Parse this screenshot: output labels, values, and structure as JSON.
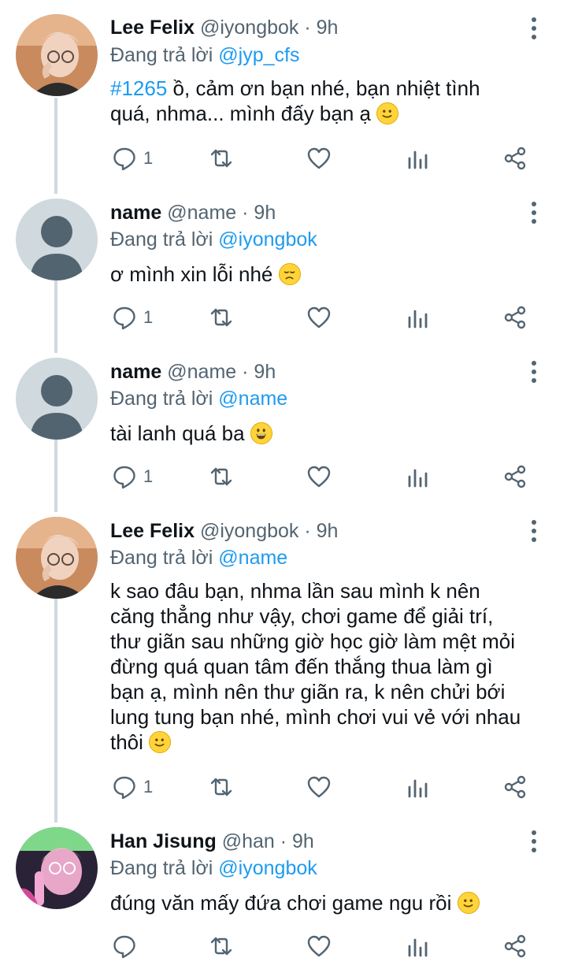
{
  "reply_prefix": "Đang trả lời",
  "tweets": [
    {
      "name": "Lee Felix",
      "handle": "@iyongbok",
      "time": "· 9h",
      "replying_to": "@jyp_cfs",
      "hashtag": "#1265",
      "text_lines": [
        "ồ, cảm ơn bạn nhé, bạn nhiệt tình",
        "quá, nhma... mình đấy bạn ạ"
      ],
      "emoji": "slightly-smiling-face",
      "reply_count": "1"
    },
    {
      "name": "name",
      "handle": "@name",
      "time": "· 9h",
      "replying_to": "@iyongbok",
      "text_lines": [
        "ơ mình xin lỗi nhé"
      ],
      "emoji": "disappointed-face",
      "reply_count": "1"
    },
    {
      "name": "name",
      "handle": "@name",
      "time": "· 9h",
      "replying_to": "@name",
      "text_lines": [
        "tài lanh quá ba"
      ],
      "emoji": "grinning-face",
      "reply_count": "1"
    },
    {
      "name": "Lee Felix",
      "handle": "@iyongbok",
      "time": "· 9h",
      "replying_to": "@name",
      "text_lines": [
        "k sao đâu bạn, nhma lần sau mình k nên",
        "căng thẳng như vậy, chơi game để giải trí,",
        "thư giãn sau những giờ học giờ làm mệt mỏi",
        "đừng quá quan tâm đến thắng thua làm gì",
        "bạn ạ, mình nên thư giãn ra, k nên chửi bới",
        "lung tung bạn nhé, mình chơi vui vẻ với nhau",
        "thôi"
      ],
      "emoji": "slightly-smiling-face",
      "reply_count": "1"
    },
    {
      "name": "Han Jisung",
      "handle": "@han",
      "time": "· 9h",
      "replying_to": "@iyongbok",
      "text_lines": [
        "đúng văn mấy đứa chơi game ngu rồi"
      ],
      "emoji": "slightly-smiling-face",
      "reply_count": ""
    }
  ],
  "icons": {
    "reply": "reply-icon",
    "retweet": "retweet-icon",
    "like": "heart-icon",
    "analytics": "analytics-icon",
    "share": "share-icon",
    "more": "more-options-icon"
  },
  "colors": {
    "link": "#1d9bf0",
    "secondary_text": "#536471",
    "thread_line": "#cfd9de"
  }
}
